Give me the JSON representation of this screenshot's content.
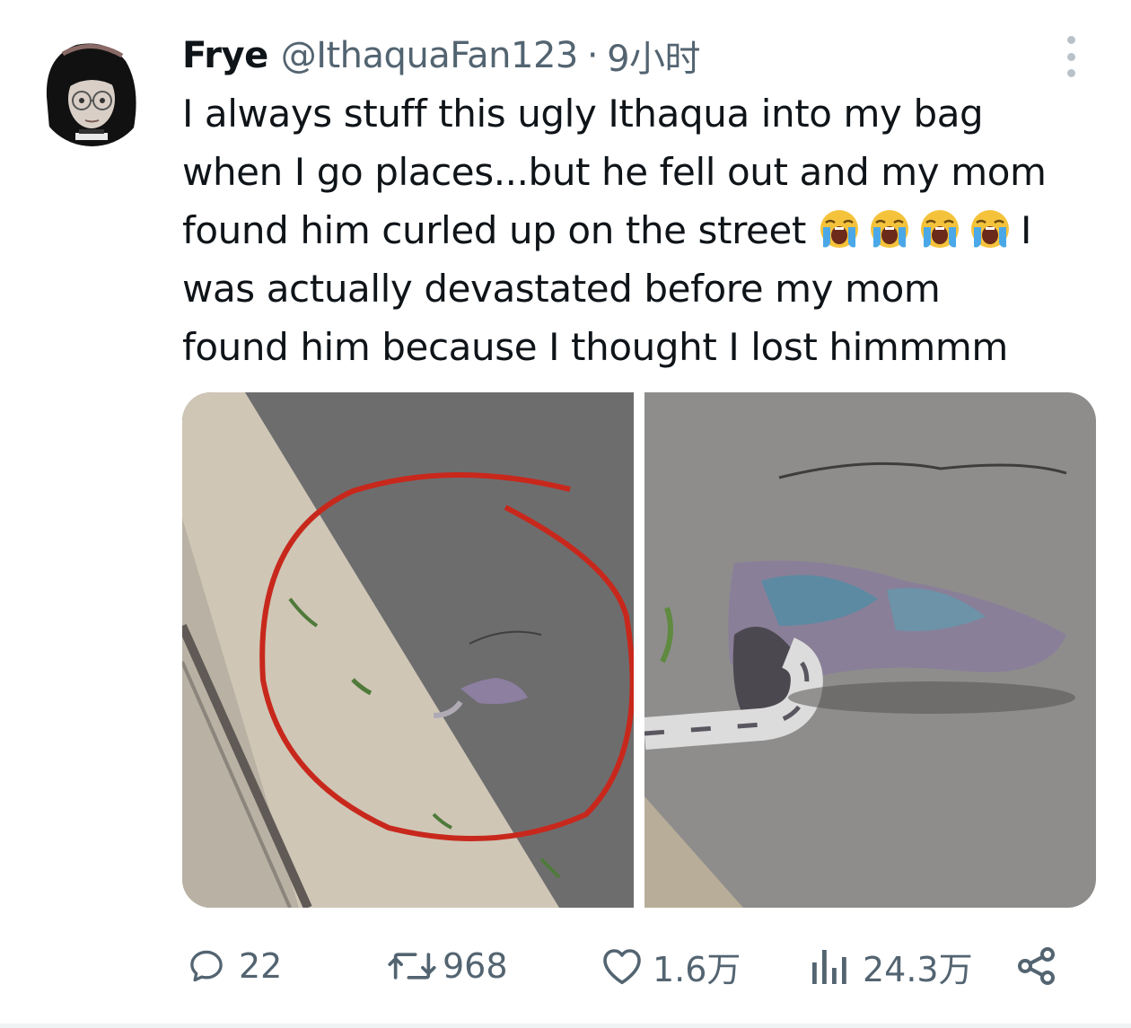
{
  "tweet": {
    "author_name": "Frye",
    "handle": "@IthaquaFan123",
    "separator": "·",
    "time": "9小时",
    "text_lines": [
      "I always stuff this ugly Ithaqua into my bag",
      "when I go places...but he fell out and my mom",
      "found him curled up on the street",
      "was actually devastated before my mom",
      "found him because I thought I lost himmmm"
    ],
    "line3_tail": "I",
    "emoji": [
      "loudly-crying-face",
      "loudly-crying-face",
      "loudly-crying-face",
      "loudly-crying-face"
    ]
  },
  "actions": {
    "replies": "22",
    "retweets": "968",
    "likes": "1.6万",
    "views": "24.3万"
  },
  "icons": {
    "more": "more-vertical-icon",
    "reply": "reply-bubble-icon",
    "retweet": "retweet-icon",
    "like": "heart-icon",
    "views": "bar-chart-icon",
    "share": "share-icon"
  },
  "colors": {
    "text": "#0f1419",
    "secondary": "#536471",
    "annotation_circle": "#c8281c"
  }
}
